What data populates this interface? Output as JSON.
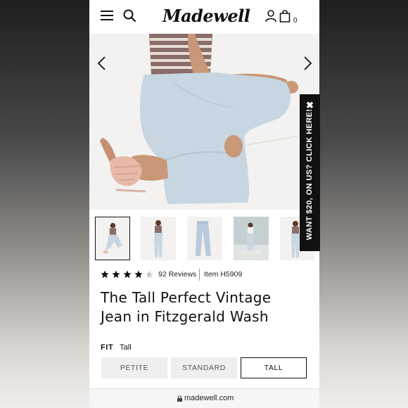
{
  "header": {
    "logo": "Madewell",
    "cart_count": "0",
    "icons": [
      "hamburger-menu-icon",
      "search-icon",
      "user-icon",
      "shopping-bag-icon"
    ]
  },
  "hero": {
    "icons": [
      "chevron-left-icon",
      "chevron-right-icon"
    ]
  },
  "promo": {
    "text": "WANT $20, ON US? CLICK HERE!",
    "close": "✖"
  },
  "product": {
    "rating": 4.5,
    "rating_max": 5,
    "reviews": "92 Reviews",
    "item_number": "Item H5909",
    "title_line1": "The Tall Perfect Vintage",
    "title_line2": "Jean in Fitzgerald Wash"
  },
  "fit": {
    "label": "FIT",
    "selected": "Tall",
    "options": [
      "PETITE",
      "STANDARD",
      "TALL"
    ]
  },
  "browser": {
    "url": "madewell.com"
  },
  "colors": {
    "accent": "#111111",
    "denim": "#c9d7e3",
    "button_bg": "#efefef"
  }
}
